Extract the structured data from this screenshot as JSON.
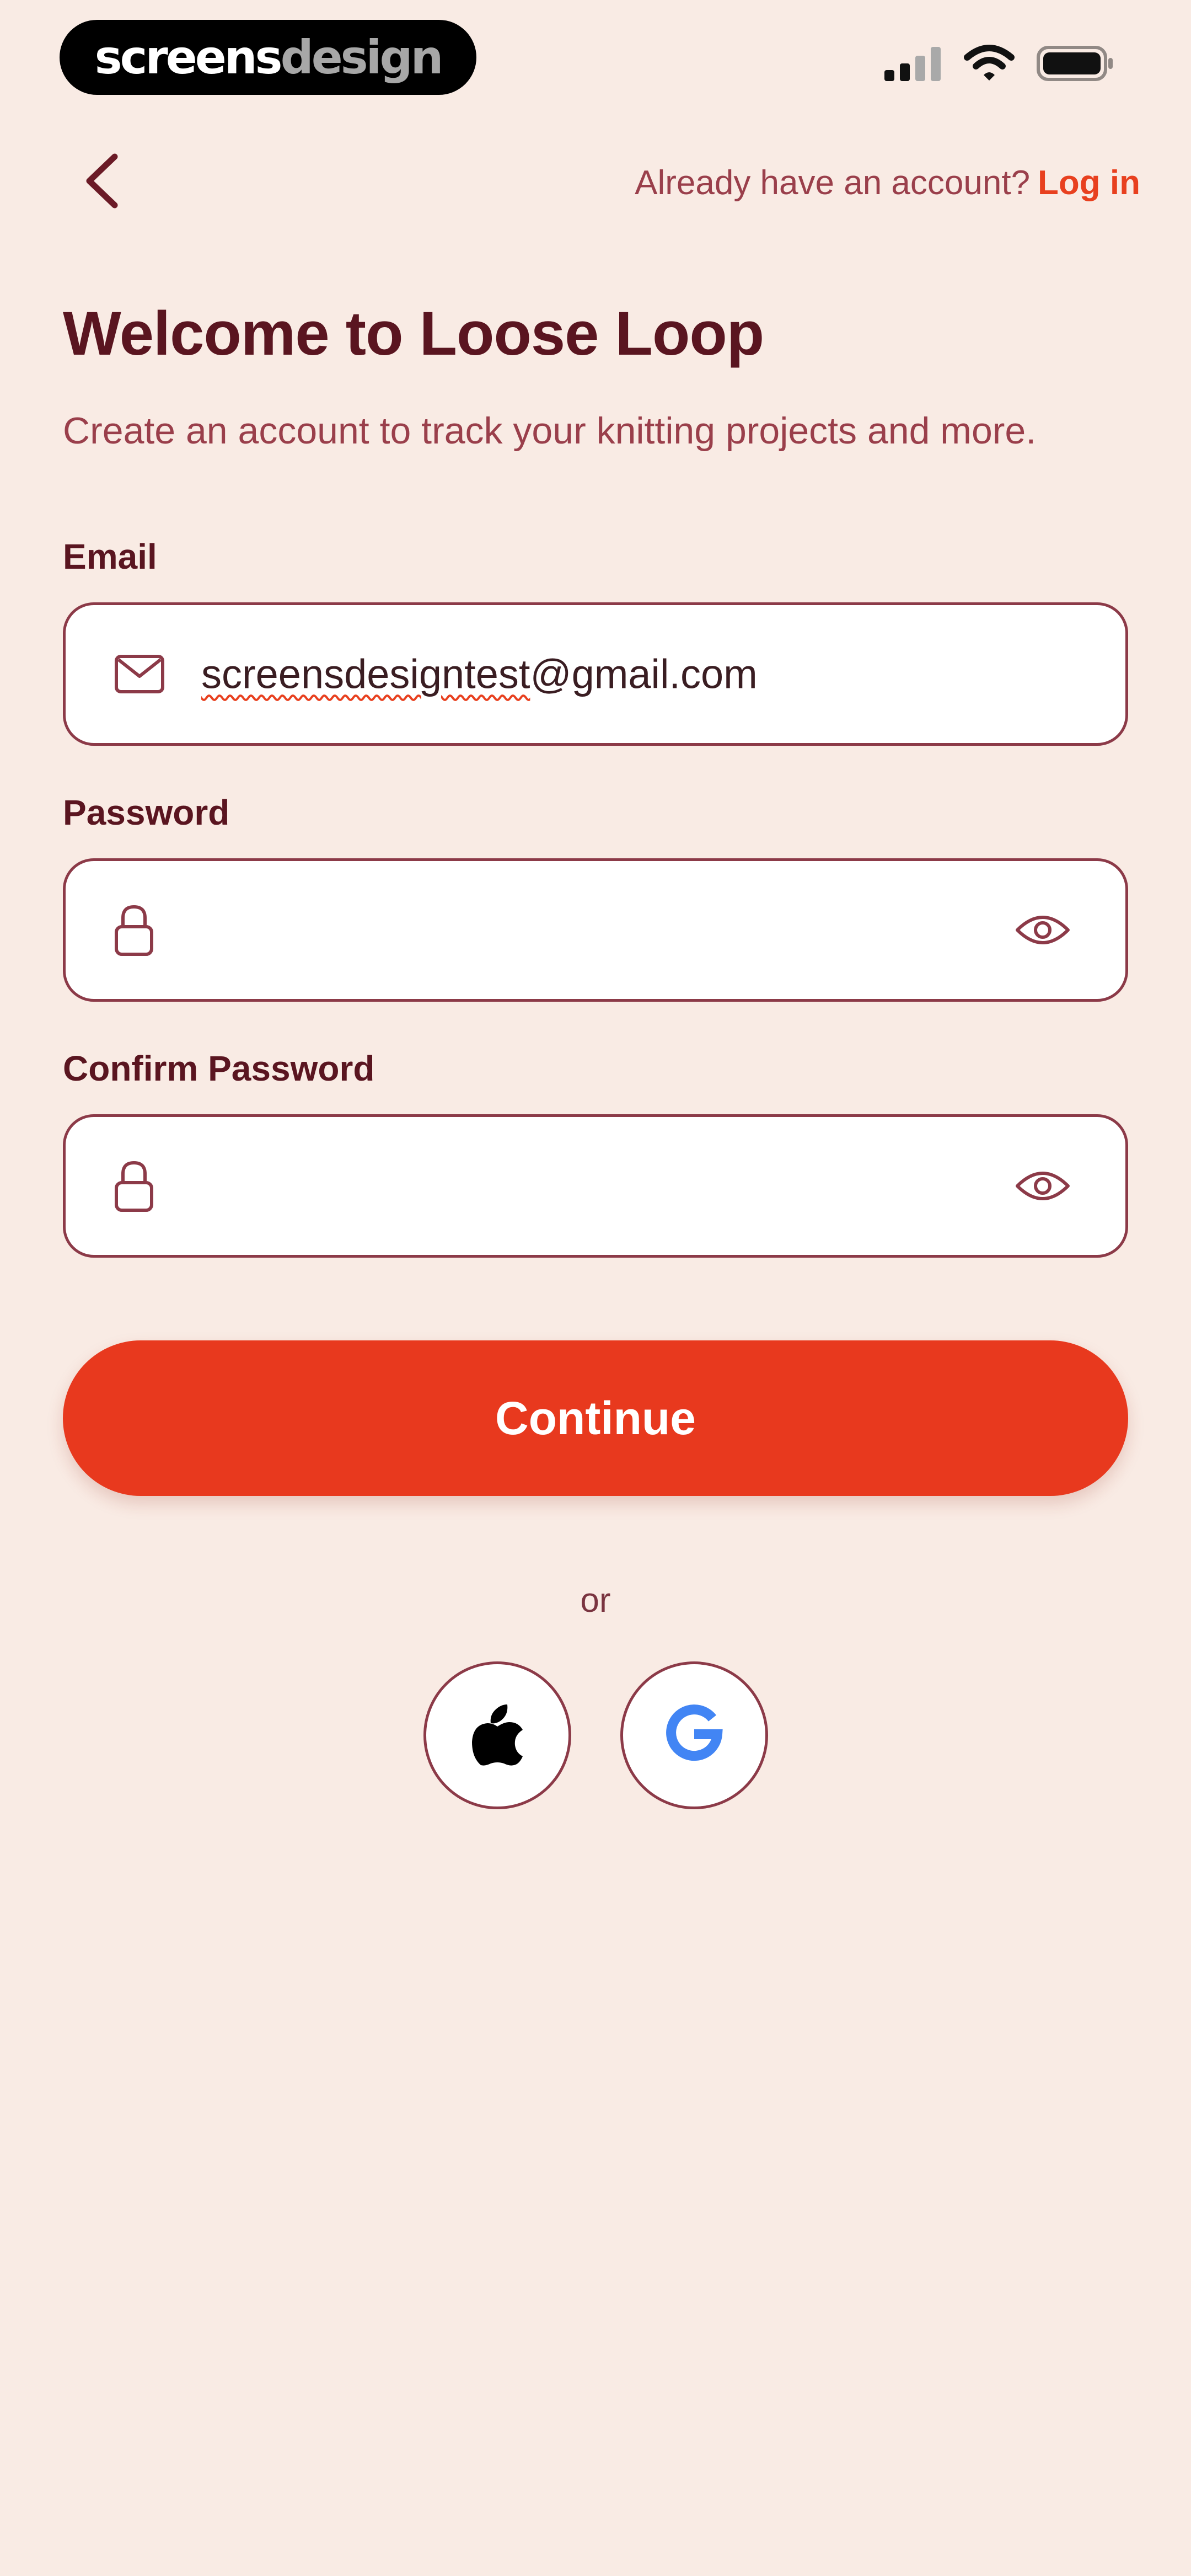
{
  "brand": {
    "part1": "screens",
    "part2": "design"
  },
  "header": {
    "prompt": "Already have an account?",
    "login_label": "Log in"
  },
  "title": "Welcome to Loose Loop",
  "subtitle": "Create an account to track your knitting projects and more.",
  "form": {
    "email": {
      "label": "Email",
      "value_underlined": "screensdesigntest",
      "value_rest": "@gmail.com"
    },
    "password": {
      "label": "Password",
      "value": ""
    },
    "confirm": {
      "label": "Confirm Password",
      "value": ""
    }
  },
  "continue_label": "Continue",
  "or_label": "or",
  "colors": {
    "background": "#f9ebe4",
    "primary": "#e8391e",
    "title": "#5a1520",
    "border": "#8c3a48",
    "accent_text": "#9a3f4b",
    "google_blue": "#4285f4"
  },
  "icons": [
    "back-chevron-icon",
    "mail-icon",
    "lock-icon",
    "eye-icon",
    "apple-icon",
    "google-icon",
    "signal-icon",
    "wifi-icon",
    "battery-icon"
  ]
}
